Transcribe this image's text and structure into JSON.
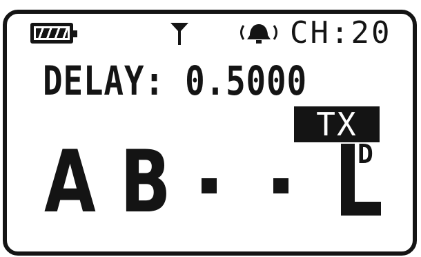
{
  "status_bar": {
    "battery_icon": "battery-full-icon",
    "antenna_icon": "antenna-icon",
    "alarm_icon": "alarm-bell-icon",
    "channel": "CH:20"
  },
  "delay": {
    "text": "DELAY: 0.5000"
  },
  "tx_badge": "TX",
  "slots": {
    "slot1": "A",
    "slot2": "B",
    "slot3": "-",
    "slot4": "-",
    "last": "L",
    "last_superscript": "D"
  }
}
